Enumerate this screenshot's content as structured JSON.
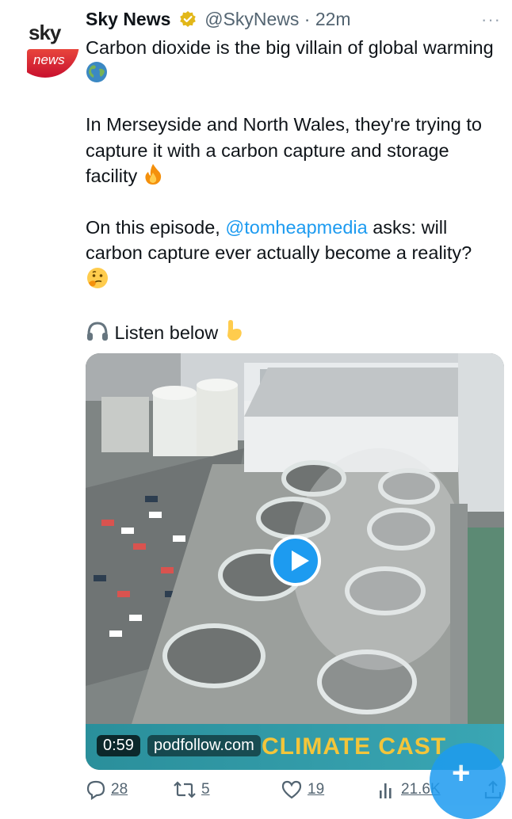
{
  "author": {
    "name": "Sky News",
    "handle": "@SkyNews",
    "separator": "·",
    "time": "22m",
    "avatar_top": "sky",
    "avatar_bottom": "news"
  },
  "more_label": "···",
  "tweet": {
    "para1": "Carbon dioxide is the big villain of global warming",
    "para2": "In Merseyside and North Wales, they're trying to capture it with a carbon capture and storage facility",
    "para3_start": "On this episode, ",
    "para3_mention": "@tomheapmedia",
    "para3_end": " asks: will carbon capture ever actually become a reality?",
    "para4": "Listen below"
  },
  "media": {
    "duration": "0:59",
    "watermark": "podfollow.com",
    "banner_text": "CLIMATE CAST"
  },
  "actions": {
    "replies": "28",
    "retweets": "5",
    "likes": "19",
    "views": "21.6K"
  },
  "colors": {
    "accent": "#1d9bf0",
    "text": "#0f1419",
    "muted": "#536471"
  }
}
